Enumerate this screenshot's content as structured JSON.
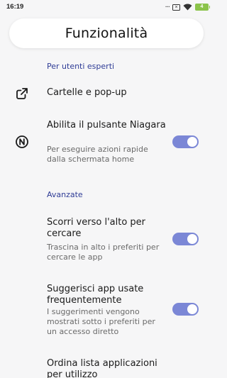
{
  "status_bar": {
    "time": "16:19",
    "overflow_dots": "...",
    "notification_box_glyph": "×",
    "battery_level": "4",
    "battery_color": "#8bc34a"
  },
  "header": {
    "title": "Funzionalità"
  },
  "sections": {
    "expert": {
      "header": "Per utenti esperti",
      "items": [
        {
          "title": "Cartelle e pop-up",
          "icon": "external-link-icon"
        },
        {
          "title": "Abilita il pulsante Niagara",
          "subtitle": "Per eseguire azioni rapide dalla schermata home",
          "icon": "niagara-n-icon",
          "toggle_on": true
        }
      ]
    },
    "advanced": {
      "header": "Avanzate",
      "items": [
        {
          "title": "Scorri verso l'alto per cercare",
          "subtitle": "Trascina in alto i preferiti per cercare le app",
          "toggle_on": true
        },
        {
          "title": "Suggerisci app usate frequentemente",
          "subtitle": "I suggerimenti vengono mostrati sotto i preferiti per un accesso diretto",
          "toggle_on": true
        },
        {
          "title": "Ordina lista applicazioni per utilizzo"
        }
      ]
    }
  },
  "colors": {
    "section_header": "#2f3c96",
    "toggle_track_on": "#7b87d6",
    "background": "#f6f6f7"
  }
}
